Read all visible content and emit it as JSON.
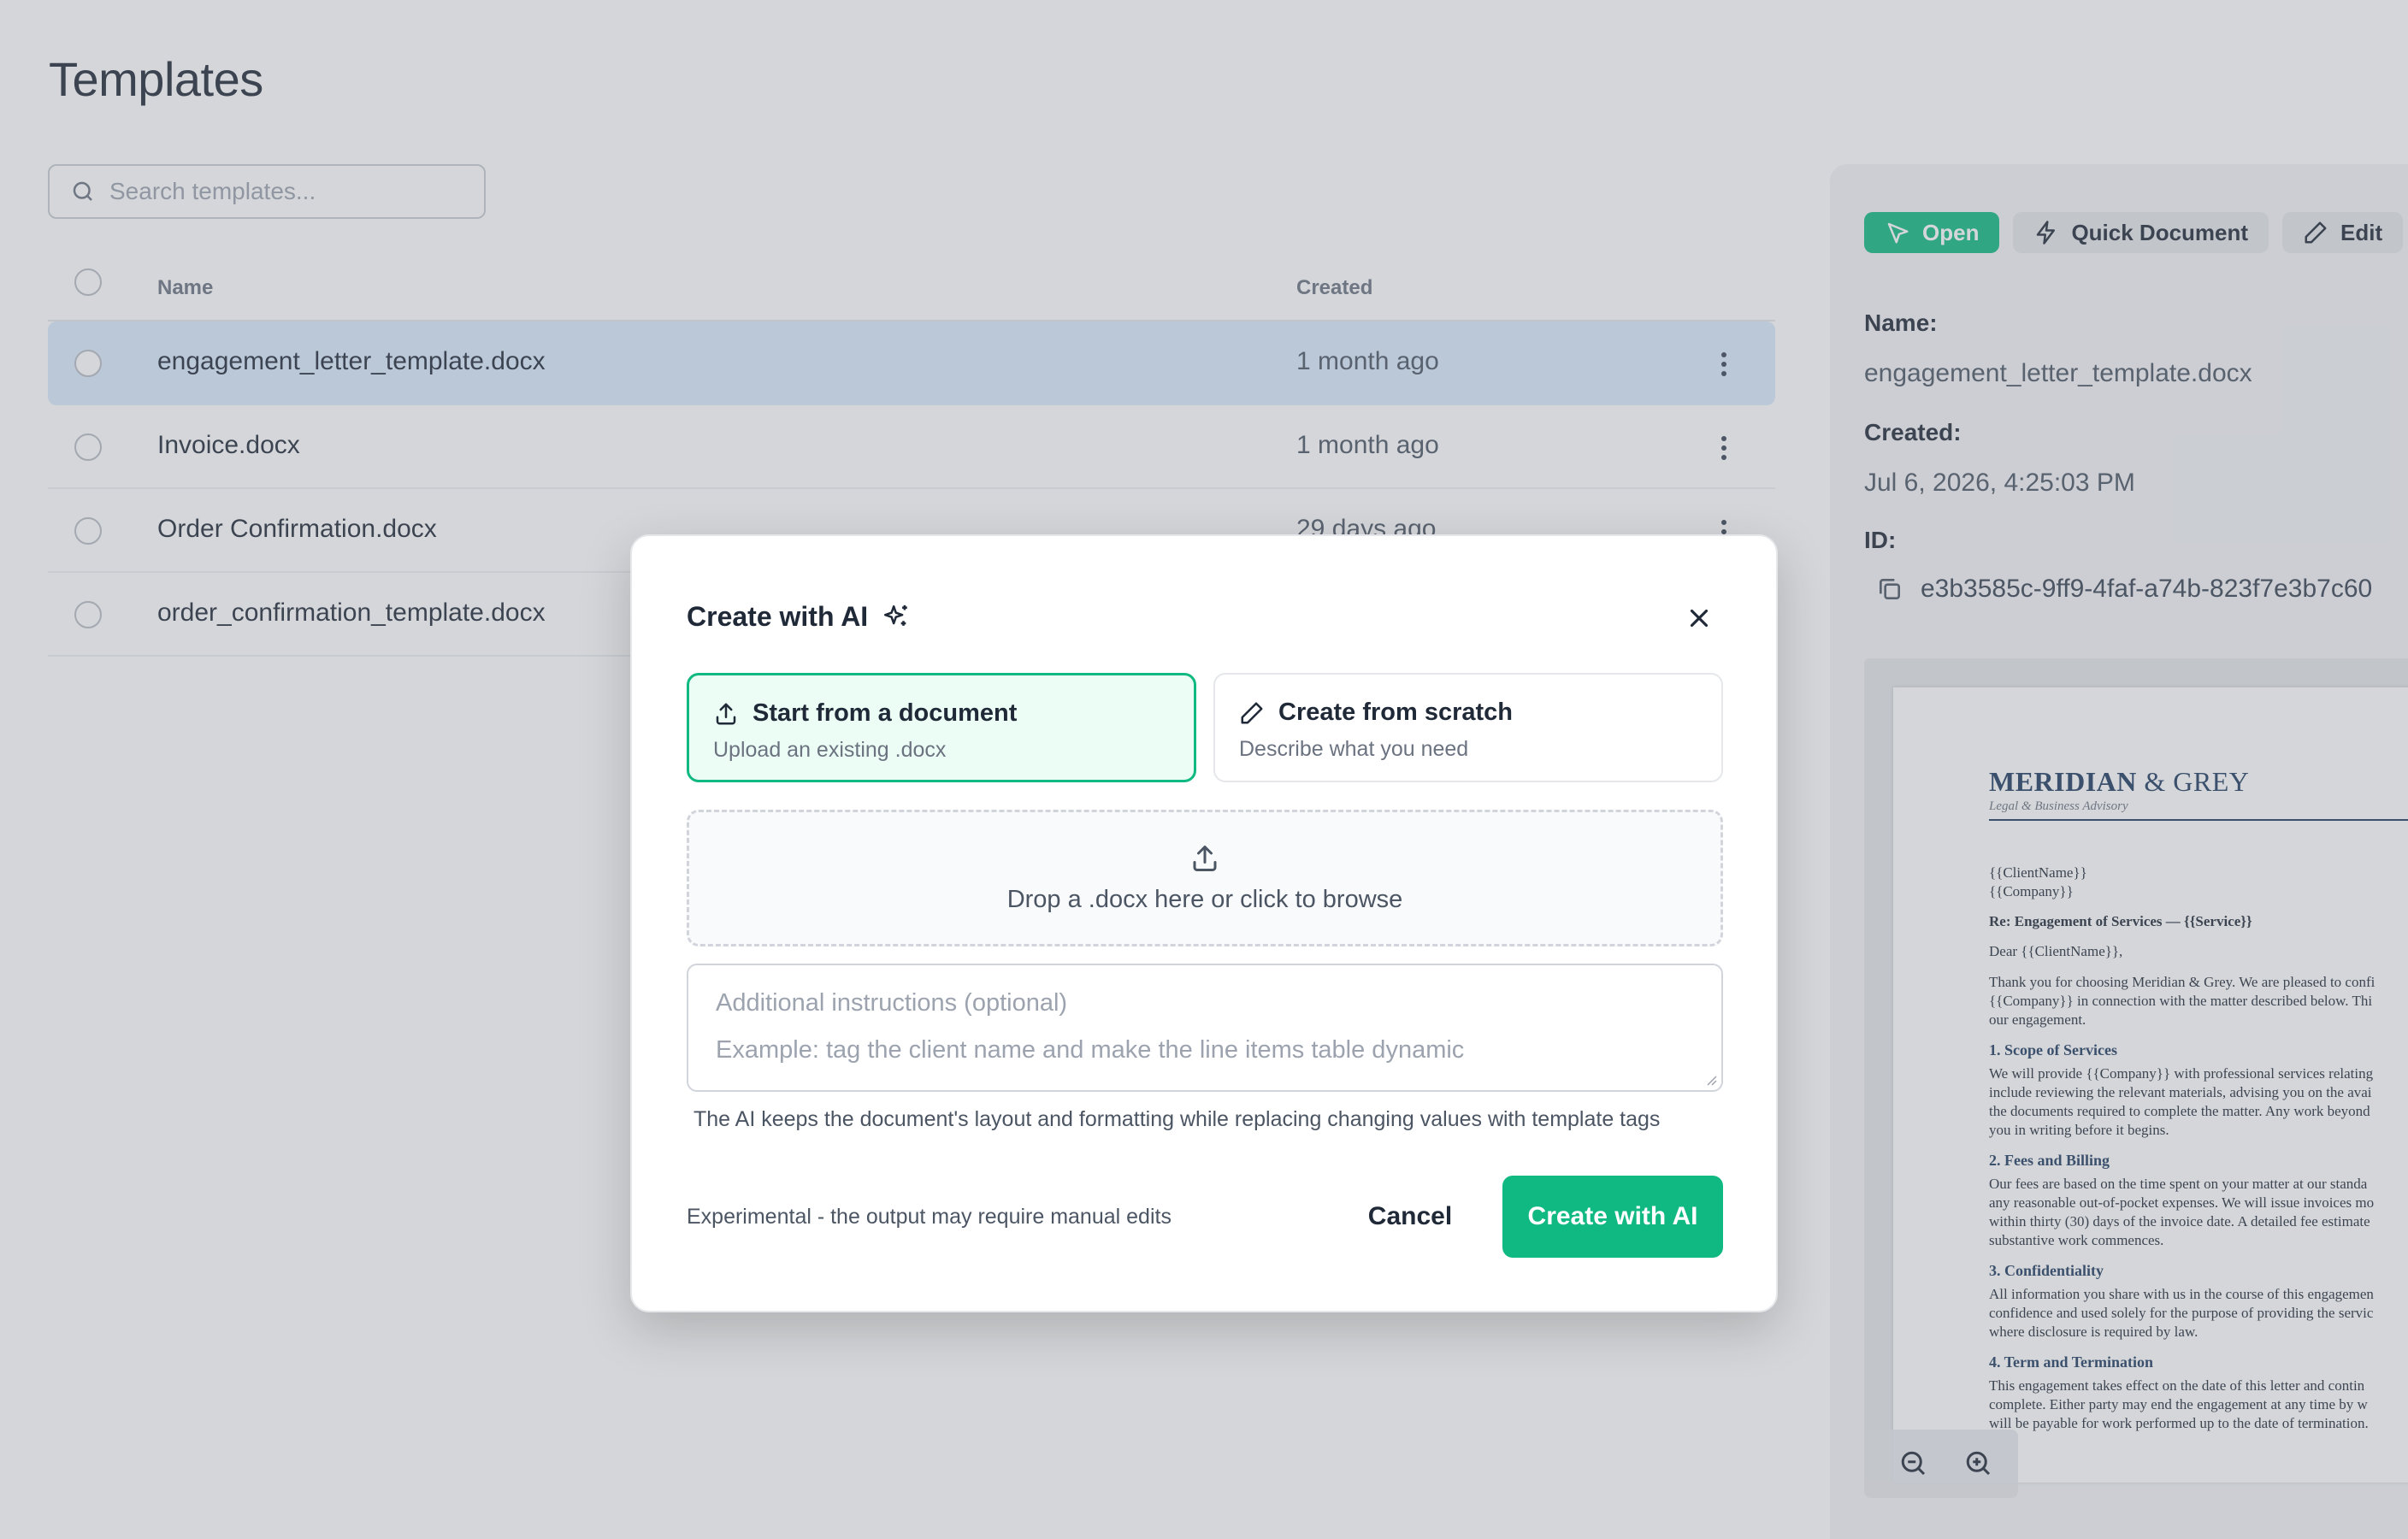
{
  "page": {
    "title": "Templates",
    "search_placeholder": "Search templates..."
  },
  "table": {
    "columns": [
      "Name",
      "Created"
    ],
    "rows": [
      {
        "name": "engagement_letter_template.docx",
        "created": "1 month ago",
        "selected": true
      },
      {
        "name": "Invoice.docx",
        "created": "1 month ago",
        "selected": false
      },
      {
        "name": "Order Confirmation.docx",
        "created": "29 days ago",
        "selected": false
      },
      {
        "name": "order_confirmation_template.docx",
        "created": "",
        "selected": false
      }
    ]
  },
  "panel": {
    "actions": {
      "open": "Open",
      "quick_document": "Quick Document",
      "edit": "Edit"
    },
    "name_label": "Name:",
    "name_value": "engagement_letter_template.docx",
    "created_label": "Created:",
    "created_value": "Jul 6, 2026, 4:25:03 PM",
    "id_label": "ID:",
    "id_value": "e3b3585c-9ff9-4faf-a74b-823f7e3b7c60",
    "preview": {
      "brand_main": "MERIDIAN",
      "brand_amp": "& GREY",
      "brand_tag": "Legal & Business Advisory",
      "address": "{{ClientName}}\n{{Company}}",
      "subject": "Re: Engagement of Services — {{Service}}",
      "salutation": "Dear {{ClientName}},",
      "intro": "Thank you for choosing Meridian & Grey. We are pleased to confi\n{{Company}} in connection with the matter described below. Thi\nour engagement.",
      "s1_title": "1. Scope of Services",
      "s1_body": "We will provide {{Company}} with professional services relating\ninclude reviewing the relevant materials, advising you on the avai\nthe documents required to complete the matter. Any work beyond\nyou in writing before it begins.",
      "s2_title": "2. Fees and Billing",
      "s2_body": "Our fees are based on the time spent on your matter at our standa\nany reasonable out-of-pocket expenses. We will issue invoices mo\nwithin thirty (30) days of the invoice date. A detailed fee estimate\nsubstantive work commences.",
      "s3_title": "3. Confidentiality",
      "s3_body": "All information you share with us in the course of this engagemen\nconfidence and used solely for the purpose of providing the servic\nwhere disclosure is required by law.",
      "s4_title": "4. Term and Termination",
      "s4_body": "This engagement takes effect on the date of this letter and contin\ncomplete. Either party may end the engagement at any time by w\nwill be payable for work performed up to the date of termination."
    }
  },
  "modal": {
    "title": "Create with AI",
    "option_document": {
      "title": "Start from a document",
      "subtitle": "Upload an existing .docx"
    },
    "option_scratch": {
      "title": "Create from scratch",
      "subtitle": "Describe what you need"
    },
    "dropzone": "Drop a .docx here or click to browse",
    "instructions_label": "Additional instructions (optional)",
    "instructions_example": "Example: tag the client name and make the line items table dynamic",
    "hint": "The AI keeps the document's layout and formatting while replacing changing values with template tags",
    "experimental": "Experimental - the output may require manual edits",
    "cancel": "Cancel",
    "submit": "Create with AI"
  },
  "colors": {
    "accent": "#10b981",
    "accent_soft": "#ecfdf5",
    "selected_row": "#dbeafe",
    "brand_navy": "#1e3a5f"
  },
  "icons": [
    "search-icon",
    "cursor-icon",
    "lightning-icon",
    "pencil-icon",
    "copy-icon",
    "zoom-out-icon",
    "zoom-in-icon",
    "sparkles-icon",
    "close-icon",
    "upload-icon",
    "kebab-icon"
  ]
}
